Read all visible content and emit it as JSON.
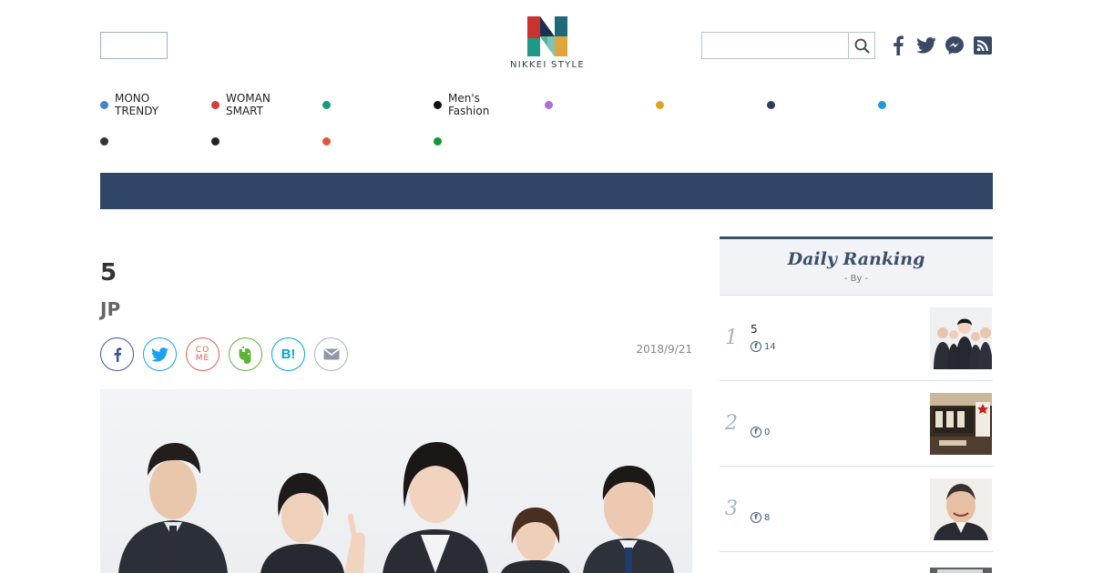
{
  "header": {
    "logo_text": "NIKKEI STYLE",
    "search_placeholder": "",
    "social_icons": [
      "facebook-icon",
      "twitter-icon",
      "messenger-icon",
      "rss-icon"
    ]
  },
  "nav": {
    "row1": [
      {
        "label": "MONO\nTRENDY",
        "color": "#4a7fd0"
      },
      {
        "label": "WOMAN\nSMART",
        "color": "#d23c3c"
      },
      {
        "label": "",
        "color": "#1a9a7a"
      },
      {
        "label": "Men's\nFashion",
        "color": "#111111"
      },
      {
        "label": "",
        "color": "#b06cd8"
      },
      {
        "label": "",
        "color": "#dca324"
      },
      {
        "label": "",
        "color": "#2f3d63"
      },
      {
        "label": "",
        "color": "#1f9bd6"
      }
    ],
    "row2": [
      {
        "label": "",
        "color": "#333333"
      },
      {
        "label": "",
        "color": "#222222"
      },
      {
        "label": "",
        "color": "#e0573a"
      },
      {
        "label": "",
        "color": "#15992b"
      }
    ]
  },
  "article": {
    "title": "5",
    "subtitle": "JP",
    "date": "2018/9/21",
    "share": {
      "comme_label": "CO\nME",
      "hatena_label": "B!"
    }
  },
  "ranking": {
    "title": "Daily Ranking",
    "by": "- By  -",
    "items": [
      {
        "num": "1",
        "text": "5",
        "fb_count": "14"
      },
      {
        "num": "2",
        "text": "",
        "fb_count": "0"
      },
      {
        "num": "3",
        "text": "",
        "fb_count": "8"
      }
    ]
  },
  "colors": {
    "banner": "#2f4666",
    "accent": "#3d4f68"
  }
}
